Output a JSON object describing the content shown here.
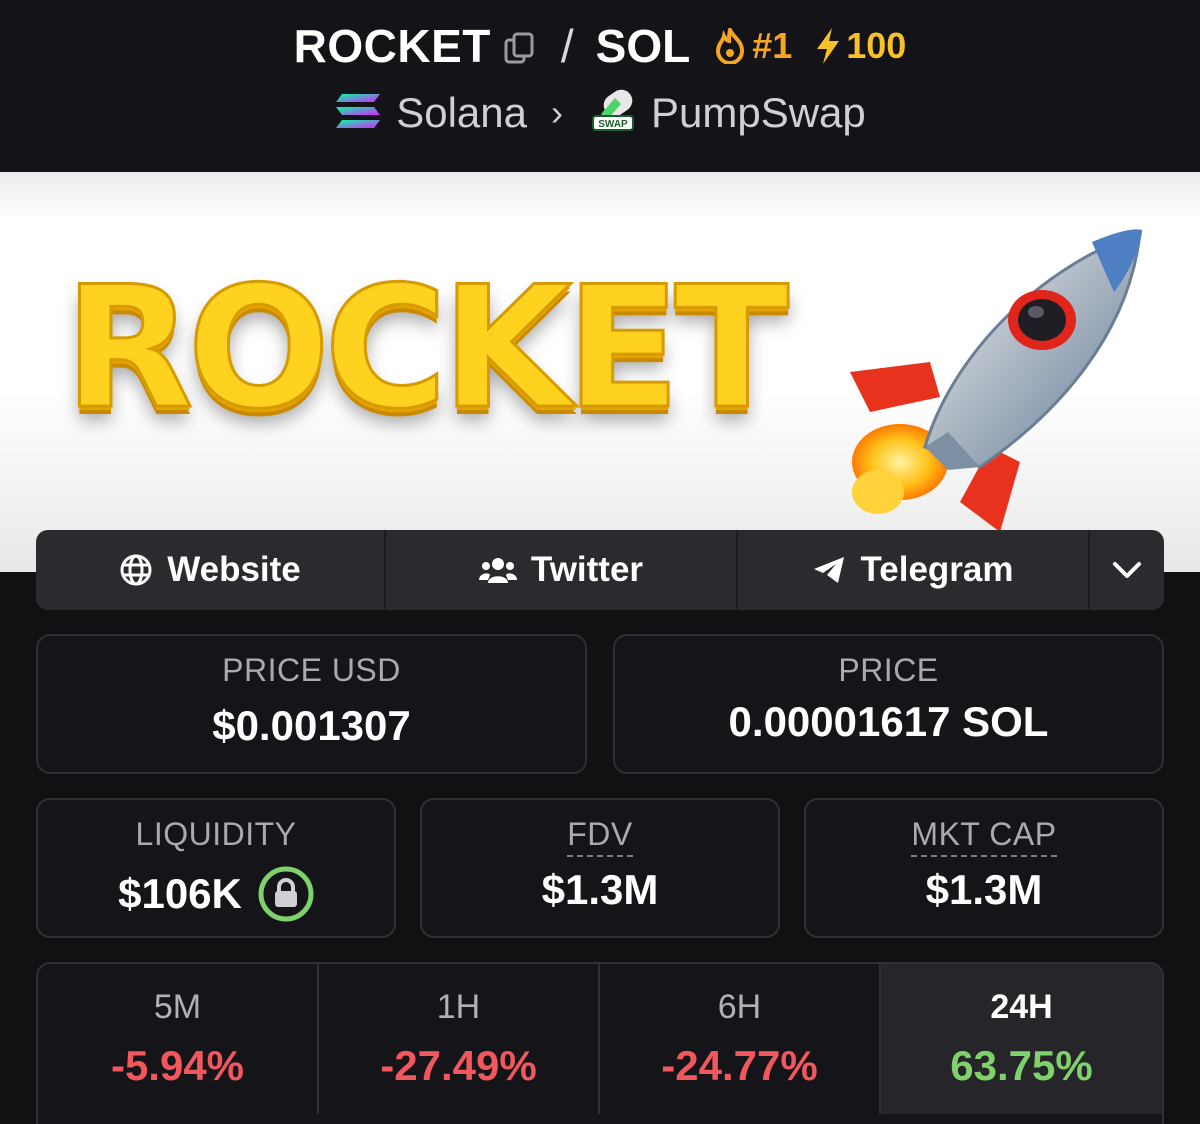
{
  "header": {
    "base_symbol": "ROCKET",
    "separator": "/",
    "quote_symbol": "SOL",
    "rank": "#1",
    "boost": "100",
    "chain": "Solana",
    "dex": "PumpSwap",
    "dex_logo_text": "SWAP",
    "icons": [
      "copy-icon",
      "flame-icon",
      "lightning-icon",
      "solana-logo-icon",
      "chevron-right-icon",
      "pumpswap-logo-icon"
    ]
  },
  "banner": {
    "title": "ROCKET",
    "image": "rocket-illustration"
  },
  "social": {
    "website": "Website",
    "twitter": "Twitter",
    "telegram": "Telegram",
    "icons": [
      "globe-icon",
      "users-icon",
      "paper-plane-icon",
      "chevron-down-icon"
    ]
  },
  "stats": {
    "price_usd_label": "PRICE USD",
    "price_usd": "$0.001307",
    "price_label": "PRICE",
    "price": "0.00001617 SOL",
    "liquidity_label": "LIQUIDITY",
    "liquidity": "$106K",
    "fdv_label": "FDV",
    "fdv": "$1.3M",
    "mcap_label": "MKT CAP",
    "mcap": "$1.3M"
  },
  "timeframes": [
    {
      "label": "5M",
      "value": "-5.94%",
      "trend": "negative"
    },
    {
      "label": "1H",
      "value": "-27.49%",
      "trend": "negative"
    },
    {
      "label": "6H",
      "value": "-24.77%",
      "trend": "negative"
    },
    {
      "label": "24H",
      "value": "63.75%",
      "trend": "positive",
      "active": true
    }
  ],
  "colors": {
    "background": "#111114",
    "positive": "#7fd16b",
    "negative": "#f0585e",
    "rank": "#f5a524",
    "boost": "#f7c12a",
    "lock_ring": "#7fd16b"
  }
}
